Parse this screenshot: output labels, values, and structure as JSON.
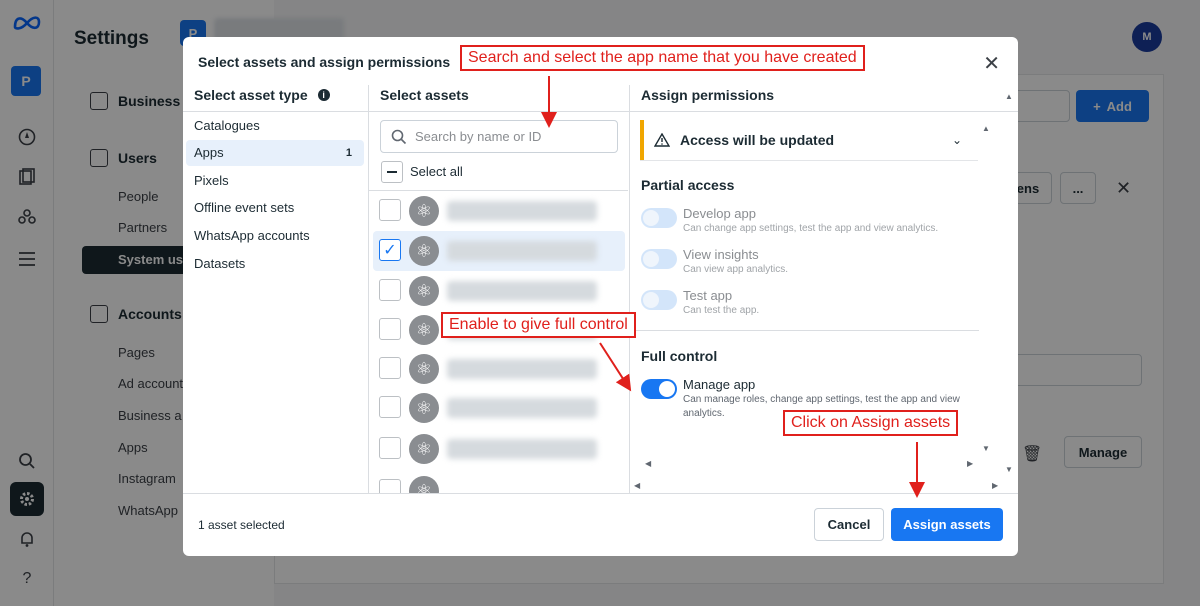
{
  "app": {
    "settings_title": "Settings",
    "business_initial": "P",
    "account_initial": "P"
  },
  "sidebar": {
    "sections": [
      {
        "label": "Business i"
      },
      {
        "label": "Users"
      },
      {
        "label": "Accounts"
      }
    ],
    "user_items": [
      "People",
      "Partners",
      "System us"
    ],
    "account_items": [
      "Pages",
      "Ad account",
      "Business a",
      "Apps",
      "Instagram",
      "WhatsApp"
    ]
  },
  "background": {
    "add_label": "Add",
    "partial_btn": "ens",
    "more_btn": "...",
    "manage_btn": "Manage"
  },
  "modal": {
    "title": "Select assets and assign permissions",
    "asset_type_header": "Select asset type",
    "select_assets_header": "Select assets",
    "assign_permissions_header": "Assign permissions",
    "asset_types": [
      {
        "label": "Catalogues",
        "count": ""
      },
      {
        "label": "Apps",
        "count": "1"
      },
      {
        "label": "Pixels",
        "count": ""
      },
      {
        "label": "Offline event sets",
        "count": ""
      },
      {
        "label": "WhatsApp accounts",
        "count": ""
      },
      {
        "label": "Datasets",
        "count": ""
      }
    ],
    "search_placeholder": "Search by name or ID",
    "select_all_label": "Select all",
    "warning_text": "Access will be updated",
    "partial_access_label": "Partial access",
    "partial_permissions": [
      {
        "name": "Develop app",
        "desc": "Can change app settings, test the app and view analytics."
      },
      {
        "name": "View insights",
        "desc": "Can view app analytics."
      },
      {
        "name": "Test app",
        "desc": "Can test the app."
      }
    ],
    "full_control_label": "Full control",
    "full_permission": {
      "name": "Manage app",
      "desc": "Can manage roles, change app settings, test the app and view analytics.",
      "enabled": true
    },
    "status_text": "1 asset selected",
    "cancel_label": "Cancel",
    "assign_label": "Assign assets"
  },
  "annotations": {
    "search_callout": "Search and select the app name that you have created",
    "toggle_callout": "Enable to give full control",
    "assign_callout": "Click on Assign assets"
  },
  "colors": {
    "accent": "#1877f2",
    "annotation": "#e0201c",
    "warning": "#f0a600"
  }
}
